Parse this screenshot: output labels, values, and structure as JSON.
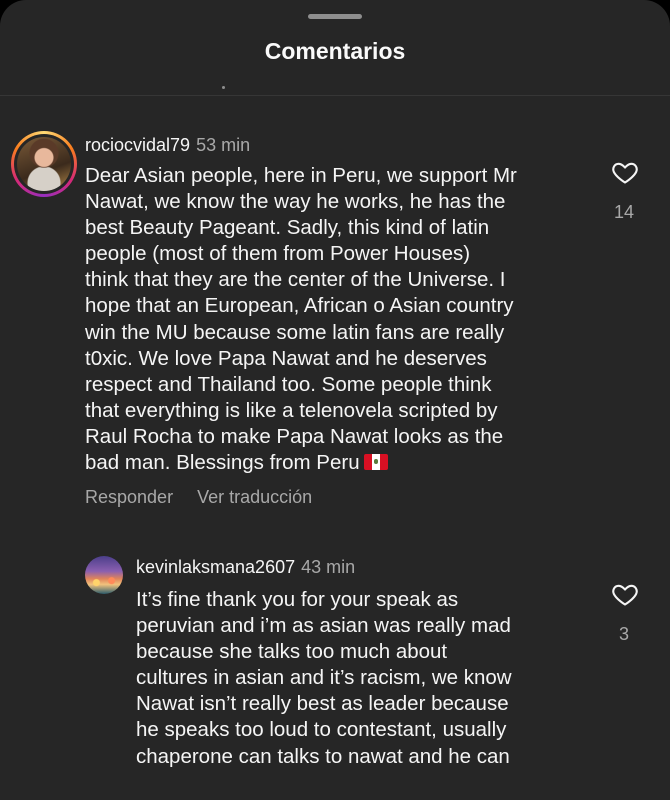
{
  "sheet": {
    "title": "Comentarios"
  },
  "comments": [
    {
      "username": "rociocvidal79",
      "time": "53 min",
      "lines": [
        "Dear Asian people, here in Peru, we support Mr",
        "Nawat, we know the way he works, he has the",
        "best Beauty Pageant. Sadly, this kind of latin",
        "people (most of them from Power Houses)",
        "think that they are the center of the Universe. I",
        "hope that an European, African o Asian country",
        "win the MU because some latin fans are really",
        "t0xic. We love Papa Nawat and he deserves",
        "respect and Thailand too. Some people think",
        "that everything is like a telenovela scripted by",
        "Raul Rocha  to make Papa Nawat looks as the",
        "bad man. Blessings from Peru"
      ],
      "flag_icon": "peru-flag-emoji",
      "likes": "14",
      "reply_label": "Responder",
      "translate_label": "Ver traducción"
    },
    {
      "username": "kevinlaksmana2607",
      "time": "43 min",
      "lines": [
        "It’s fine thank you for your speak as",
        "peruvian and i’m as asian was really mad",
        "because she talks too much about",
        "cultures in asian and it’s racism, we know",
        "Nawat isn’t really best as leader because",
        "he speaks too loud to contestant, usually",
        "chaperone can talks to nawat and he can"
      ],
      "likes": "3"
    }
  ],
  "colors": {
    "background": "#262626",
    "text": "#f5f5f5",
    "secondary_text": "#a8a8a8",
    "peru_red": "#d91023"
  }
}
